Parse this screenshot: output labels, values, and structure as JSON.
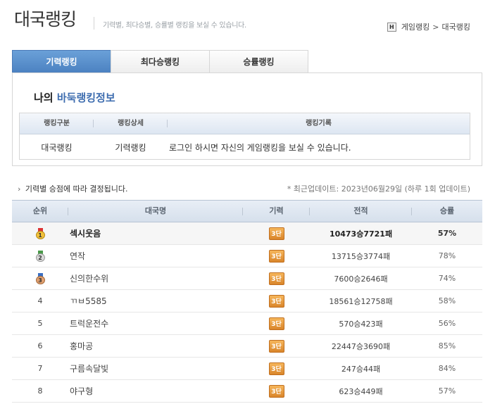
{
  "header": {
    "title": "대국랭킹",
    "description": "기력별, 최다승별, 승률별 랭킹을 보실 수 있습니다.",
    "breadcrumb": {
      "home_icon_label": "H",
      "parent": "게임랭킹",
      "separator": ">",
      "current": "대국랭킹"
    }
  },
  "tabs": [
    {
      "label": "기력랭킹",
      "active": true
    },
    {
      "label": "최다승랭킹",
      "active": false
    },
    {
      "label": "승률랭킹",
      "active": false
    }
  ],
  "my_ranking": {
    "title_plain": "나의",
    "title_highlight": "바둑랭킹정보",
    "columns": [
      "랭킹구분",
      "랭킹상세",
      "랭킹기록"
    ],
    "row": {
      "category": "대국랭킹",
      "detail": "기력랭킹",
      "record": "로그인 하시면 자신의 게임랭킹을 보실 수 있습니다."
    }
  },
  "notice": {
    "arrow": "›",
    "text": "기력별 승점에 따라 결정됩니다."
  },
  "update_info": "* 최근업데이트: 2023년06월29일 (하루 1회 업데이트)",
  "ranking_table": {
    "columns": [
      "순위",
      "대국명",
      "기력",
      "전적",
      "승률"
    ],
    "rows": [
      {
        "rank": "1",
        "medal": "gold-medal-icon",
        "name": "섹시웃음",
        "level": "3단",
        "record": "10473승7721패",
        "rate": "57%"
      },
      {
        "rank": "2",
        "medal": "silver-medal-icon",
        "name": "연작",
        "level": "3단",
        "record": "13715승3774패",
        "rate": "78%"
      },
      {
        "rank": "3",
        "medal": "bronze-medal-icon",
        "name": "신의한수위",
        "level": "3단",
        "record": "7600승2646패",
        "rate": "74%"
      },
      {
        "rank": "4",
        "name": "ㄲㅂ5585",
        "level": "3단",
        "record": "18561승12758패",
        "rate": "58%"
      },
      {
        "rank": "5",
        "name": "트럭운전수",
        "level": "3단",
        "record": "570승423패",
        "rate": "56%"
      },
      {
        "rank": "6",
        "name": "홍마공",
        "level": "3단",
        "record": "22447승3690패",
        "rate": "85%"
      },
      {
        "rank": "7",
        "name": "구름속달빛",
        "level": "3단",
        "record": "247승44패",
        "rate": "84%"
      },
      {
        "rank": "8",
        "name": "야구형",
        "level": "3단",
        "record": "623승449패",
        "rate": "57%"
      }
    ]
  },
  "colors": {
    "tab_active": "#4a80c0",
    "highlight": "#3f6eb0",
    "level_badge": "#e89a3c"
  }
}
